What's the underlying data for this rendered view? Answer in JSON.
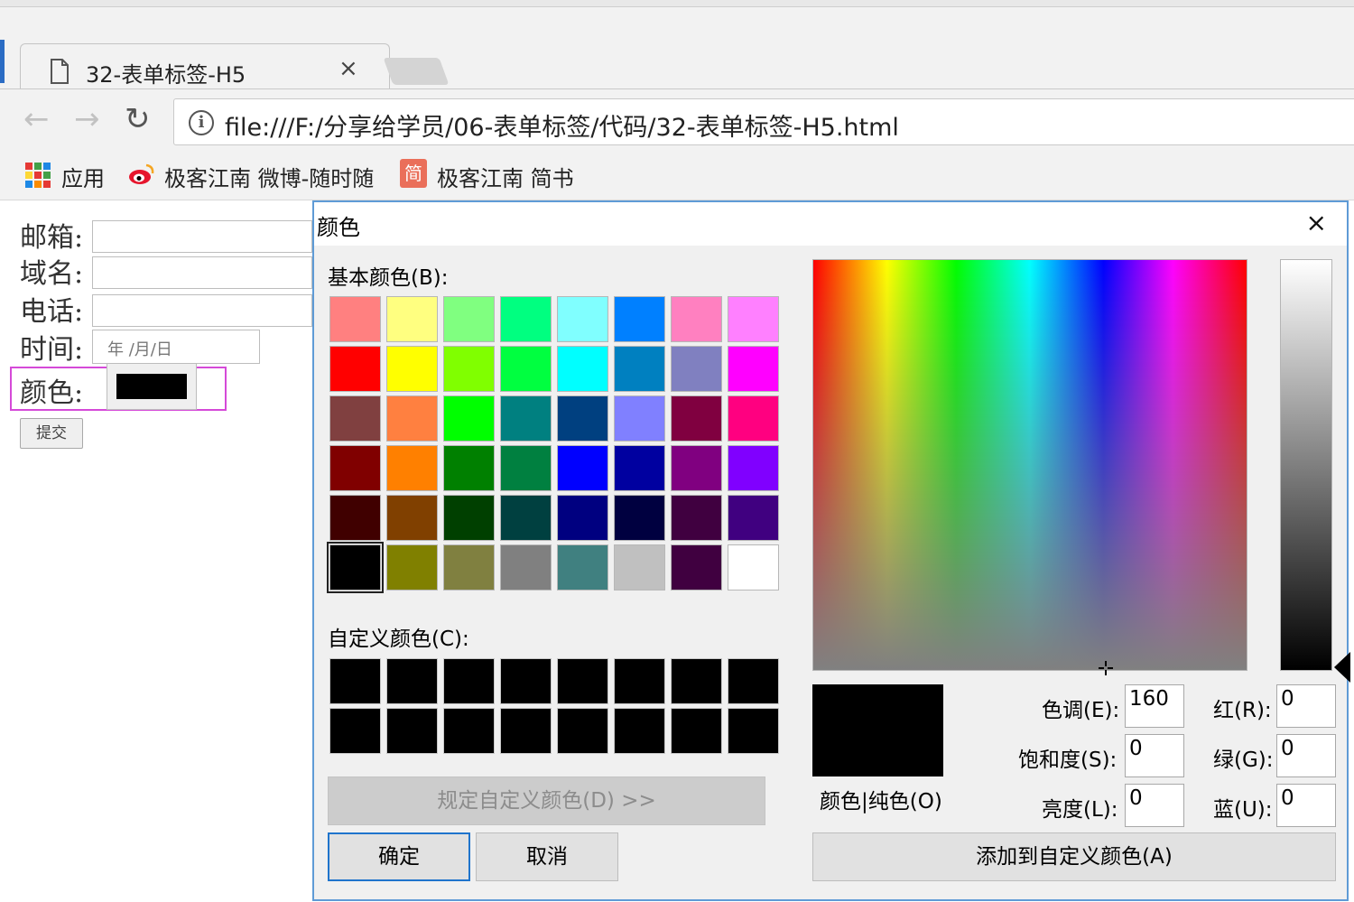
{
  "browser": {
    "tab_title": "32-表单标签-H5",
    "tab_close": "×",
    "nav": {
      "back": "←",
      "forward": "→",
      "reload": "↻"
    },
    "url": "file:///F:/分享给学员/06-表单标签/代码/32-表单标签-H5.html",
    "info_icon": "i",
    "bookmarks": [
      {
        "label": "应用",
        "icon": "apps-icon"
      },
      {
        "label": "极客江南 微博-随时随",
        "icon": "weibo-icon"
      },
      {
        "label": "极客江南 简书",
        "icon": "jianshu-icon",
        "icon_text": "简"
      }
    ]
  },
  "form": {
    "email_label": "邮箱:",
    "domain_label": "域名:",
    "phone_label": "电话:",
    "time_label": "时间:",
    "date_placeholder": "年 /月/日",
    "color_label": "颜色:",
    "color_value": "#000000",
    "submit_label": "提交"
  },
  "dialog": {
    "title": "颜色",
    "close": "×",
    "basic_colors_label": "基本颜色(B):",
    "basic_colors": [
      [
        "#ff8080",
        "#ffff80",
        "#80ff80",
        "#00ff80",
        "#80ffff",
        "#0080ff",
        "#ff80c0",
        "#ff80ff"
      ],
      [
        "#ff0000",
        "#ffff00",
        "#80ff00",
        "#00ff40",
        "#00ffff",
        "#0080c0",
        "#8080c0",
        "#ff00ff"
      ],
      [
        "#804040",
        "#ff8040",
        "#00ff00",
        "#008080",
        "#004080",
        "#8080ff",
        "#800040",
        "#ff0080"
      ],
      [
        "#800000",
        "#ff8000",
        "#008000",
        "#008040",
        "#0000ff",
        "#0000a0",
        "#800080",
        "#8000ff"
      ],
      [
        "#400000",
        "#804000",
        "#004000",
        "#004040",
        "#000080",
        "#000040",
        "#400040",
        "#400080"
      ],
      [
        "#000000",
        "#808000",
        "#808040",
        "#808080",
        "#408080",
        "#c0c0c0",
        "#400040",
        "#ffffff"
      ]
    ],
    "custom_colors_label": "自定义颜色(C):",
    "define_custom_label": "规定自定义颜色(D) >>",
    "ok_label": "确定",
    "cancel_label": "取消",
    "preview_label": "颜色|纯色(O)",
    "hue_label": "色调(E):",
    "hue_value": "160",
    "sat_label": "饱和度(S):",
    "sat_value": "0",
    "lum_label": "亮度(L):",
    "lum_value": "0",
    "red_label": "红(R):",
    "red_value": "0",
    "green_label": "绿(G):",
    "green_value": "0",
    "blue_label": "蓝(U):",
    "blue_value": "0",
    "add_custom_label": "添加到自定义颜色(A)"
  }
}
